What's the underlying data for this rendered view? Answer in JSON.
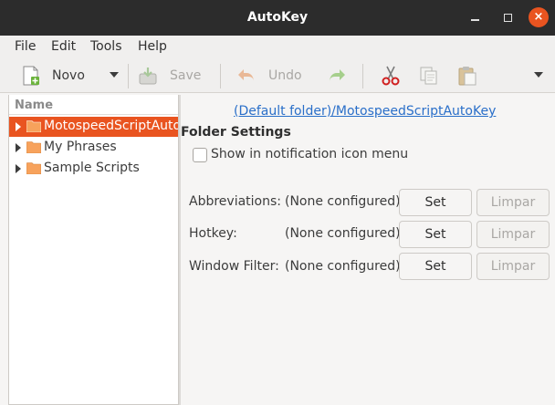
{
  "window": {
    "title": "AutoKey"
  },
  "menubar": {
    "items": [
      "File",
      "Edit",
      "Tools",
      "Help"
    ]
  },
  "toolbar": {
    "new_label": "Novo",
    "save_label": "Save",
    "undo_label": "Undo"
  },
  "tree": {
    "header": "Name",
    "items": [
      {
        "label": "MotospeedScriptAutoKey",
        "selected": true
      },
      {
        "label": "My Phrases",
        "selected": false
      },
      {
        "label": "Sample Scripts",
        "selected": false
      }
    ]
  },
  "folder_panel": {
    "link": "(Default folder)/MotospeedScriptAutoKey",
    "section_title": "Folder Settings",
    "notification_checkbox": {
      "label": "Show in notification icon menu",
      "checked": false
    },
    "rows": [
      {
        "label": "Abbreviations:",
        "value": "(None configured)",
        "set_label": "Set",
        "clear_label": "Limpar"
      },
      {
        "label": "Hotkey:",
        "value": "(None configured)",
        "set_label": "Set",
        "clear_label": "Limpar"
      },
      {
        "label": "Window Filter:",
        "value": "(None configured)",
        "set_label": "Set",
        "clear_label": "Limpar"
      }
    ]
  },
  "colors": {
    "accent": "#e95420",
    "titlebar": "#2c2c2c",
    "link": "#2a6fc9",
    "folder": "#f7a25c"
  }
}
